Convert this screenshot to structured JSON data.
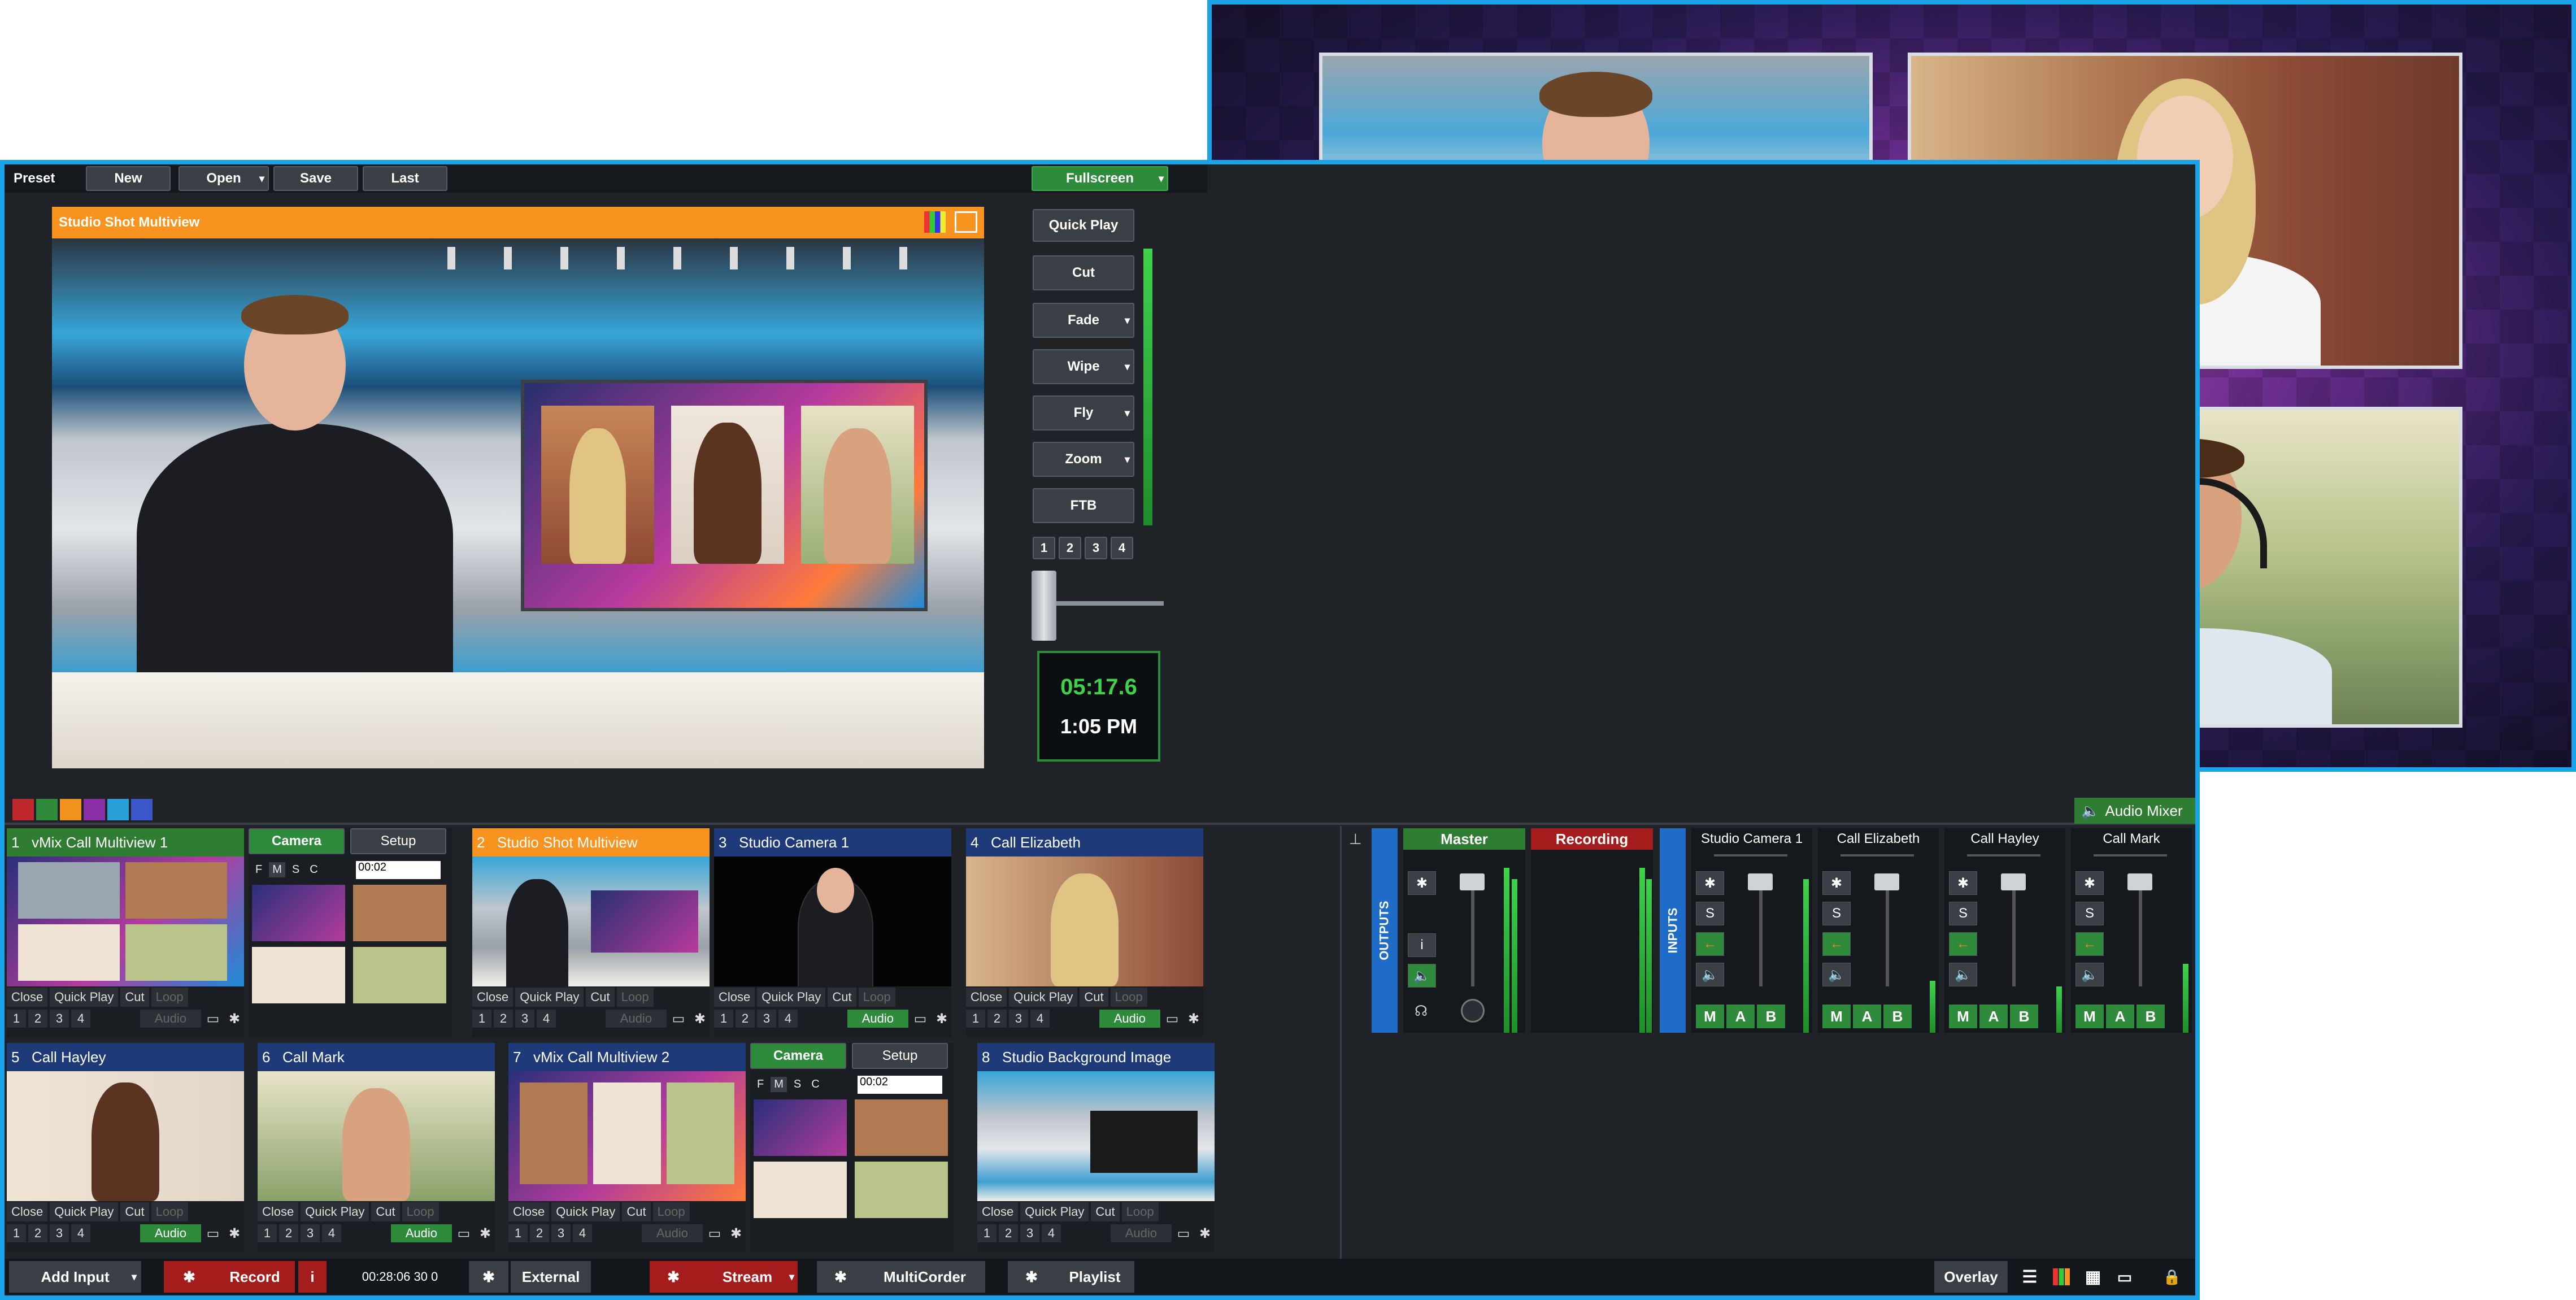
{
  "top_toolbar": {
    "preset": "Preset",
    "new": "New",
    "open": "Open",
    "save": "Save",
    "last": "Last",
    "fullscreen": "Fullscreen"
  },
  "preview": {
    "title": "Studio Shot Multiview"
  },
  "transitions": {
    "quick_play": "Quick Play",
    "cut": "Cut",
    "fade": "Fade",
    "wipe": "Wipe",
    "fly": "Fly",
    "zoom": "Zoom",
    "ftb": "FTB",
    "numbers": [
      "1",
      "2",
      "3",
      "4"
    ]
  },
  "clock": {
    "elapsed": "05:17.6",
    "time": "1:05 PM"
  },
  "color_swatches": [
    "#c0282d",
    "#2f8a3b",
    "#f0931e",
    "#8b2fa6",
    "#2aa0d8",
    "#3b56c8"
  ],
  "audio_mixer_tab": "Audio Mixer",
  "inputs": [
    {
      "num": "1",
      "title": "vMix Call Multiview 1",
      "color": "#2e7d32"
    },
    {
      "num": "2",
      "title": "Studio Shot Multiview",
      "color": "#f7931e"
    },
    {
      "num": "3",
      "title": "Studio Camera 1",
      "color": "#1e3a78"
    },
    {
      "num": "4",
      "title": "Call Elizabeth",
      "color": "#1e3a78"
    },
    {
      "num": "5",
      "title": "Call Hayley",
      "color": "#1e3a78"
    },
    {
      "num": "6",
      "title": "Call Mark",
      "color": "#1e3a78"
    },
    {
      "num": "7",
      "title": "vMix Call Multiview 2",
      "color": "#1e3a78"
    },
    {
      "num": "8",
      "title": "Studio Background Image",
      "color": "#1e3a78"
    }
  ],
  "tile_controls": {
    "close": "Close",
    "quick_play": "Quick Play",
    "cut": "Cut",
    "loop": "Loop",
    "audio": "Audio",
    "nums": [
      "1",
      "2",
      "3",
      "4"
    ]
  },
  "camera_panel": {
    "camera": "Camera",
    "setup": "Setup",
    "modes": [
      "F",
      "M",
      "S",
      "C"
    ],
    "time": "00:02"
  },
  "mixer": {
    "outputs_label": "OUTPUTS",
    "inputs_label": "INPUTS",
    "master": "Master",
    "recording": "Recording",
    "channels": [
      "Studio Camera 1",
      "Call Elizabeth",
      "Call Hayley",
      "Call Mark"
    ],
    "buttons": {
      "i": "i",
      "s": "S",
      "m": "M",
      "a": "A",
      "b": "B"
    }
  },
  "bottom_bar": {
    "add_input": "Add Input",
    "record": "Record",
    "record_info": "i",
    "record_time": "00:28:06 30 0",
    "external": "External",
    "stream": "Stream",
    "multicorder": "MultiCorder",
    "playlist": "Playlist",
    "overlay": "Overlay"
  }
}
